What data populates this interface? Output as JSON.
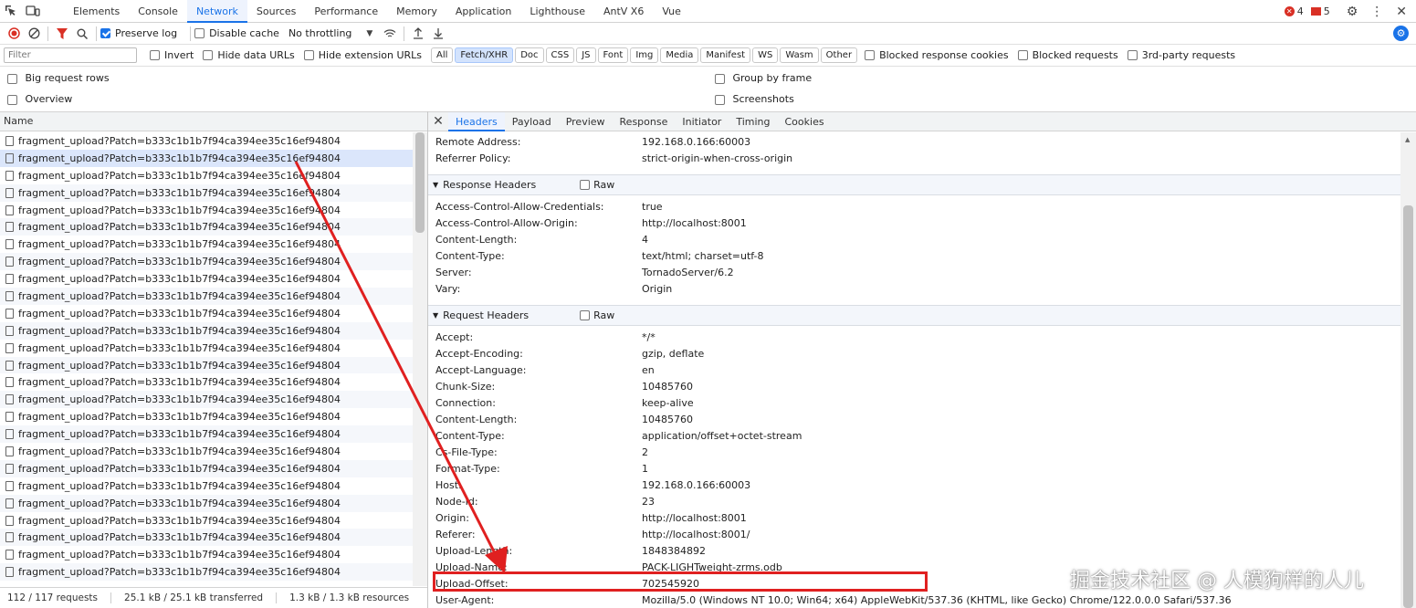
{
  "devtools": {
    "tabs": [
      "Elements",
      "Console",
      "Network",
      "Sources",
      "Performance",
      "Memory",
      "Application",
      "Lighthouse",
      "AntV X6",
      "Vue"
    ],
    "active_tab": "Network",
    "errors_count": "4",
    "warnings_count": "5"
  },
  "toolbar": {
    "preserve_log": "Preserve log",
    "disable_cache": "Disable cache",
    "throttling": "No throttling"
  },
  "filterbar": {
    "placeholder": "Filter",
    "invert": "Invert",
    "hide_data_urls": "Hide data URLs",
    "hide_extension_urls": "Hide extension URLs",
    "types": [
      "All",
      "Fetch/XHR",
      "Doc",
      "CSS",
      "JS",
      "Font",
      "Img",
      "Media",
      "Manifest",
      "WS",
      "Wasm",
      "Other"
    ],
    "active_type": "Fetch/XHR",
    "blocked_response_cookies": "Blocked response cookies",
    "blocked_requests": "Blocked requests",
    "third_party_requests": "3rd-party requests"
  },
  "options": {
    "big_request_rows": "Big request rows",
    "overview": "Overview",
    "group_by_frame": "Group by frame",
    "screenshots": "Screenshots"
  },
  "list": {
    "header": "Name",
    "item_name": "fragment_upload?Patch=b333c1b1b7f94ca394ee35c16ef94804",
    "row_count": 26,
    "selected_index": 1
  },
  "status": {
    "requests": "112 / 117 requests",
    "transferred": "25.1 kB / 25.1 kB transferred",
    "resources": "1.3 kB / 1.3 kB resources"
  },
  "detail": {
    "tabs": [
      "Headers",
      "Payload",
      "Preview",
      "Response",
      "Initiator",
      "Timing",
      "Cookies"
    ],
    "active_tab": "Headers",
    "general": [
      {
        "k": "Remote Address:",
        "v": "192.168.0.166:60003"
      },
      {
        "k": "Referrer Policy:",
        "v": "strict-origin-when-cross-origin"
      }
    ],
    "response_title": "Response Headers",
    "raw_label": "Raw",
    "response": [
      {
        "k": "Access-Control-Allow-Credentials:",
        "v": "true"
      },
      {
        "k": "Access-Control-Allow-Origin:",
        "v": "http://localhost:8001"
      },
      {
        "k": "Content-Length:",
        "v": "4"
      },
      {
        "k": "Content-Type:",
        "v": "text/html; charset=utf-8"
      },
      {
        "k": "Server:",
        "v": "TornadoServer/6.2"
      },
      {
        "k": "Vary:",
        "v": "Origin"
      }
    ],
    "request_title": "Request Headers",
    "request": [
      {
        "k": "Accept:",
        "v": "*/*"
      },
      {
        "k": "Accept-Encoding:",
        "v": "gzip, deflate"
      },
      {
        "k": "Accept-Language:",
        "v": "en"
      },
      {
        "k": "Chunk-Size:",
        "v": "10485760"
      },
      {
        "k": "Connection:",
        "v": "keep-alive"
      },
      {
        "k": "Content-Length:",
        "v": "10485760"
      },
      {
        "k": "Content-Type:",
        "v": "application/offset+octet-stream"
      },
      {
        "k": "Cs-File-Type:",
        "v": "2"
      },
      {
        "k": "Format-Type:",
        "v": "1"
      },
      {
        "k": "Host:",
        "v": "192.168.0.166:60003"
      },
      {
        "k": "Node-Id:",
        "v": "23"
      },
      {
        "k": "Origin:",
        "v": "http://localhost:8001"
      },
      {
        "k": "Referer:",
        "v": "http://localhost:8001/"
      },
      {
        "k": "Upload-Length:",
        "v": "1848384892"
      },
      {
        "k": "Upload-Name:",
        "v": "PACK-LIGHTweight-zrms.odb"
      },
      {
        "k": "Upload-Offset:",
        "v": "702545920"
      },
      {
        "k": "User-Agent:",
        "v": "Mozilla/5.0 (Windows NT 10.0; Win64; x64) AppleWebKit/537.36 (KHTML, like Gecko) Chrome/122.0.0.0 Safari/537.36"
      }
    ]
  },
  "annotation": {
    "color": "#e02020"
  },
  "watermark": "掘金技术社区 @ 人模狗样的人儿"
}
